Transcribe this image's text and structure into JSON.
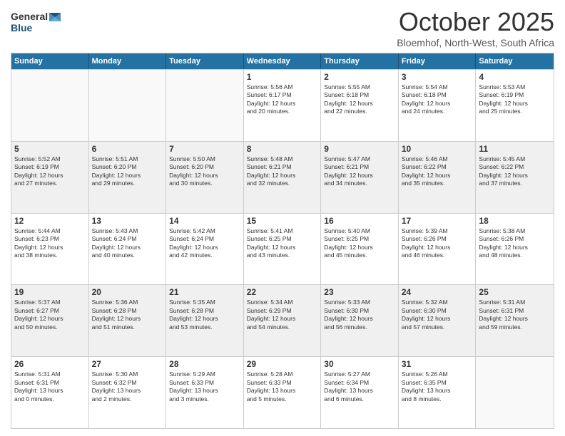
{
  "header": {
    "logo_general": "General",
    "logo_blue": "Blue",
    "month_title": "October 2025",
    "location": "Bloemhof, North-West, South Africa"
  },
  "days_of_week": [
    "Sunday",
    "Monday",
    "Tuesday",
    "Wednesday",
    "Thursday",
    "Friday",
    "Saturday"
  ],
  "weeks": [
    [
      {
        "day": "",
        "info": "",
        "empty": true
      },
      {
        "day": "",
        "info": "",
        "empty": true
      },
      {
        "day": "",
        "info": "",
        "empty": true
      },
      {
        "day": "1",
        "info": "Sunrise: 5:56 AM\nSunset: 6:17 PM\nDaylight: 12 hours\nand 20 minutes."
      },
      {
        "day": "2",
        "info": "Sunrise: 5:55 AM\nSunset: 6:18 PM\nDaylight: 12 hours\nand 22 minutes."
      },
      {
        "day": "3",
        "info": "Sunrise: 5:54 AM\nSunset: 6:18 PM\nDaylight: 12 hours\nand 24 minutes."
      },
      {
        "day": "4",
        "info": "Sunrise: 5:53 AM\nSunset: 6:19 PM\nDaylight: 12 hours\nand 25 minutes."
      }
    ],
    [
      {
        "day": "5",
        "info": "Sunrise: 5:52 AM\nSunset: 6:19 PM\nDaylight: 12 hours\nand 27 minutes."
      },
      {
        "day": "6",
        "info": "Sunrise: 5:51 AM\nSunset: 6:20 PM\nDaylight: 12 hours\nand 29 minutes."
      },
      {
        "day": "7",
        "info": "Sunrise: 5:50 AM\nSunset: 6:20 PM\nDaylight: 12 hours\nand 30 minutes."
      },
      {
        "day": "8",
        "info": "Sunrise: 5:48 AM\nSunset: 6:21 PM\nDaylight: 12 hours\nand 32 minutes."
      },
      {
        "day": "9",
        "info": "Sunrise: 5:47 AM\nSunset: 6:21 PM\nDaylight: 12 hours\nand 34 minutes."
      },
      {
        "day": "10",
        "info": "Sunrise: 5:46 AM\nSunset: 6:22 PM\nDaylight: 12 hours\nand 35 minutes."
      },
      {
        "day": "11",
        "info": "Sunrise: 5:45 AM\nSunset: 6:22 PM\nDaylight: 12 hours\nand 37 minutes."
      }
    ],
    [
      {
        "day": "12",
        "info": "Sunrise: 5:44 AM\nSunset: 6:23 PM\nDaylight: 12 hours\nand 38 minutes."
      },
      {
        "day": "13",
        "info": "Sunrise: 5:43 AM\nSunset: 6:24 PM\nDaylight: 12 hours\nand 40 minutes."
      },
      {
        "day": "14",
        "info": "Sunrise: 5:42 AM\nSunset: 6:24 PM\nDaylight: 12 hours\nand 42 minutes."
      },
      {
        "day": "15",
        "info": "Sunrise: 5:41 AM\nSunset: 6:25 PM\nDaylight: 12 hours\nand 43 minutes."
      },
      {
        "day": "16",
        "info": "Sunrise: 5:40 AM\nSunset: 6:25 PM\nDaylight: 12 hours\nand 45 minutes."
      },
      {
        "day": "17",
        "info": "Sunrise: 5:39 AM\nSunset: 6:26 PM\nDaylight: 12 hours\nand 46 minutes."
      },
      {
        "day": "18",
        "info": "Sunrise: 5:38 AM\nSunset: 6:26 PM\nDaylight: 12 hours\nand 48 minutes."
      }
    ],
    [
      {
        "day": "19",
        "info": "Sunrise: 5:37 AM\nSunset: 6:27 PM\nDaylight: 12 hours\nand 50 minutes."
      },
      {
        "day": "20",
        "info": "Sunrise: 5:36 AM\nSunset: 6:28 PM\nDaylight: 12 hours\nand 51 minutes."
      },
      {
        "day": "21",
        "info": "Sunrise: 5:35 AM\nSunset: 6:28 PM\nDaylight: 12 hours\nand 53 minutes."
      },
      {
        "day": "22",
        "info": "Sunrise: 5:34 AM\nSunset: 6:29 PM\nDaylight: 12 hours\nand 54 minutes."
      },
      {
        "day": "23",
        "info": "Sunrise: 5:33 AM\nSunset: 6:30 PM\nDaylight: 12 hours\nand 56 minutes."
      },
      {
        "day": "24",
        "info": "Sunrise: 5:32 AM\nSunset: 6:30 PM\nDaylight: 12 hours\nand 57 minutes."
      },
      {
        "day": "25",
        "info": "Sunrise: 5:31 AM\nSunset: 6:31 PM\nDaylight: 12 hours\nand 59 minutes."
      }
    ],
    [
      {
        "day": "26",
        "info": "Sunrise: 5:31 AM\nSunset: 6:31 PM\nDaylight: 13 hours\nand 0 minutes."
      },
      {
        "day": "27",
        "info": "Sunrise: 5:30 AM\nSunset: 6:32 PM\nDaylight: 13 hours\nand 2 minutes."
      },
      {
        "day": "28",
        "info": "Sunrise: 5:29 AM\nSunset: 6:33 PM\nDaylight: 13 hours\nand 3 minutes."
      },
      {
        "day": "29",
        "info": "Sunrise: 5:28 AM\nSunset: 6:33 PM\nDaylight: 13 hours\nand 5 minutes."
      },
      {
        "day": "30",
        "info": "Sunrise: 5:27 AM\nSunset: 6:34 PM\nDaylight: 13 hours\nand 6 minutes."
      },
      {
        "day": "31",
        "info": "Sunrise: 5:26 AM\nSunset: 6:35 PM\nDaylight: 13 hours\nand 8 minutes."
      },
      {
        "day": "",
        "info": "",
        "empty": true
      }
    ]
  ]
}
